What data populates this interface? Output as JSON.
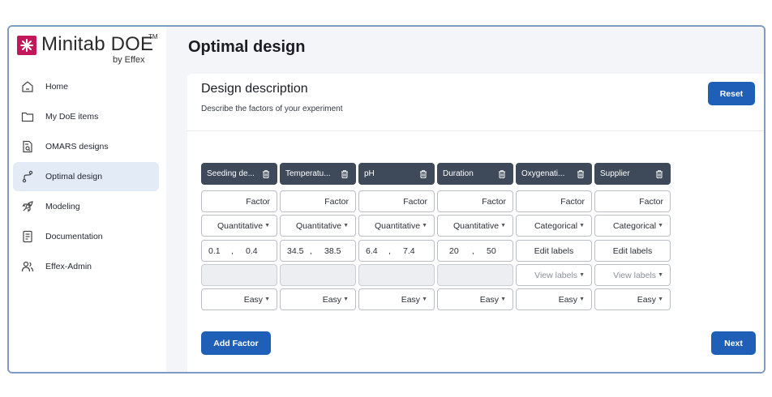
{
  "brand": {
    "name": "Minitab DOE",
    "tm": "TM",
    "sub": "by Effex",
    "accent": "#c2185b"
  },
  "nav": [
    {
      "label": "Home",
      "icon": "home-icon"
    },
    {
      "label": "My DoE items",
      "icon": "folder-icon"
    },
    {
      "label": "OMARS designs",
      "icon": "document-search-icon"
    },
    {
      "label": "Optimal design",
      "icon": "flow-icon",
      "active": true
    },
    {
      "label": "Modeling",
      "icon": "rocket-icon"
    },
    {
      "label": "Documentation",
      "icon": "document-icon"
    },
    {
      "label": "Effex-Admin",
      "icon": "users-icon"
    }
  ],
  "page": {
    "title": "Optimal design"
  },
  "card": {
    "title": "Design description",
    "subtitle": "Describe the factors of your experiment",
    "reset_label": "Reset",
    "add_factor_label": "Add Factor",
    "next_label": "Next"
  },
  "factors": [
    {
      "name": "Seeding de...",
      "role": "Factor",
      "type": "Quantitative",
      "low": "0.1",
      "high": "0.4",
      "sep": ",",
      "difficulty": "Easy"
    },
    {
      "name": "Temperatu...",
      "role": "Factor",
      "type": "Quantitative",
      "low": "34.5",
      "high": "38.5",
      "sep": ",",
      "difficulty": "Easy"
    },
    {
      "name": "pH",
      "role": "Factor",
      "type": "Quantitative",
      "low": "6.4",
      "high": "7.4",
      "sep": ",",
      "difficulty": "Easy"
    },
    {
      "name": "Duration",
      "role": "Factor",
      "type": "Quantitative",
      "low": "20",
      "high": "50",
      "sep": ",",
      "difficulty": "Easy"
    },
    {
      "name": "Oxygenati...",
      "role": "Factor",
      "type": "Categorical",
      "edit_labels": "Edit labels",
      "view_labels": "View labels",
      "difficulty": "Easy"
    },
    {
      "name": "Supplier",
      "role": "Factor",
      "type": "Categorical",
      "edit_labels": "Edit labels",
      "view_labels": "View labels",
      "difficulty": "Easy"
    }
  ],
  "colors": {
    "primary": "#1f5fb8",
    "header": "#3e4a5a",
    "active_nav": "#e3ebf7"
  }
}
